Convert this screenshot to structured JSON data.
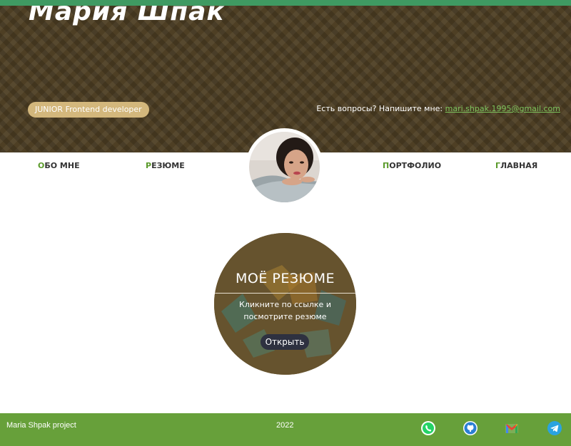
{
  "header": {
    "name": "Мария Шпак",
    "role_badge": "JUNIOR Frontend developer",
    "contact_prompt": "Есть вопросы? Напишите мне: ",
    "email": "mari.shpak.1995@gmail.com"
  },
  "nav": {
    "about": "Обо мне",
    "resume": "Резюме",
    "portfolio": "Портфолио",
    "home": "Главная"
  },
  "resume_card": {
    "title": "МОЁ РЕЗЮМЕ",
    "text": "Кликните по ссылке и посмотрите резюме",
    "button": "Открыть"
  },
  "footer": {
    "project": "Maria Shpak project",
    "year": "2022",
    "icons": [
      "whatsapp-icon",
      "github-icon",
      "gmail-icon",
      "telegram-icon"
    ]
  },
  "colors": {
    "accent_green": "#67a03a",
    "header_brown": "#4e3f24",
    "badge_tan": "#d3b77c",
    "link_green": "#7cc35c"
  }
}
